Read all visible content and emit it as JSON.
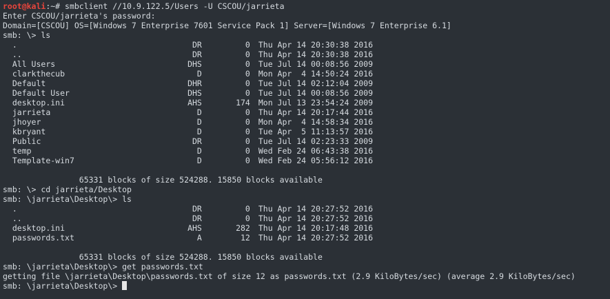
{
  "terminal": {
    "prompt_user": "root@kali",
    "prompt_rest": ":~# ",
    "command": "smbclient //10.9.122.5/Users -U CSCOU/jarrieta",
    "password_prompt": "Enter CSCOU/jarrieta's password:",
    "domain_info": "Domain=[CSCOU] OS=[Windows 7 Enterprise 7601 Service Pack 1] Server=[Windows 7 Enterprise 6.1]",
    "smb_prompt_root_ls": "smb: \\> ls",
    "root_listing": [
      {
        "name": ".",
        "attr": "DR",
        "size": "0",
        "date": "Thu Apr 14 20:30:38 2016"
      },
      {
        "name": "..",
        "attr": "DR",
        "size": "0",
        "date": "Thu Apr 14 20:30:38 2016"
      },
      {
        "name": "All Users",
        "attr": "DHS",
        "size": "0",
        "date": "Tue Jul 14 00:08:56 2009"
      },
      {
        "name": "clarkthecub",
        "attr": "D",
        "size": "0",
        "date": "Mon Apr  4 14:50:24 2016"
      },
      {
        "name": "Default",
        "attr": "DHR",
        "size": "0",
        "date": "Tue Jul 14 02:12:04 2009"
      },
      {
        "name": "Default User",
        "attr": "DHS",
        "size": "0",
        "date": "Tue Jul 14 00:08:56 2009"
      },
      {
        "name": "desktop.ini",
        "attr": "AHS",
        "size": "174",
        "date": "Mon Jul 13 23:54:24 2009"
      },
      {
        "name": "jarrieta",
        "attr": "D",
        "size": "0",
        "date": "Thu Apr 14 20:17:44 2016"
      },
      {
        "name": "jhoyer",
        "attr": "D",
        "size": "0",
        "date": "Mon Apr  4 14:58:34 2016"
      },
      {
        "name": "kbryant",
        "attr": "D",
        "size": "0",
        "date": "Tue Apr  5 11:13:57 2016"
      },
      {
        "name": "Public",
        "attr": "DR",
        "size": "0",
        "date": "Tue Jul 14 02:23:33 2009"
      },
      {
        "name": "temp",
        "attr": "D",
        "size": "0",
        "date": "Wed Feb 24 06:43:38 2016"
      },
      {
        "name": "Template-win7",
        "attr": "D",
        "size": "0",
        "date": "Wed Feb 24 05:56:12 2016"
      }
    ],
    "blocks_summary_1": "                65331 blocks of size 524288. 15850 blocks available",
    "cd_command": "smb: \\> cd jarrieta/Desktop",
    "desktop_ls": "smb: \\jarrieta\\Desktop\\> ls",
    "desktop_listing": [
      {
        "name": ".",
        "attr": "DR",
        "size": "0",
        "date": "Thu Apr 14 20:27:52 2016"
      },
      {
        "name": "..",
        "attr": "DR",
        "size": "0",
        "date": "Thu Apr 14 20:27:52 2016"
      },
      {
        "name": "desktop.ini",
        "attr": "AHS",
        "size": "282",
        "date": "Thu Apr 14 20:17:48 2016"
      },
      {
        "name": "passwords.txt",
        "attr": "A",
        "size": "12",
        "date": "Thu Apr 14 20:27:52 2016"
      }
    ],
    "blocks_summary_2": "                65331 blocks of size 524288. 15850 blocks available",
    "get_command": "smb: \\jarrieta\\Desktop\\> get passwords.txt",
    "get_result": "getting file \\jarrieta\\Desktop\\passwords.txt of size 12 as passwords.txt (2.9 KiloBytes/sec) (average 2.9 KiloBytes/sec)",
    "final_prompt": "smb: \\jarrieta\\Desktop\\> "
  }
}
